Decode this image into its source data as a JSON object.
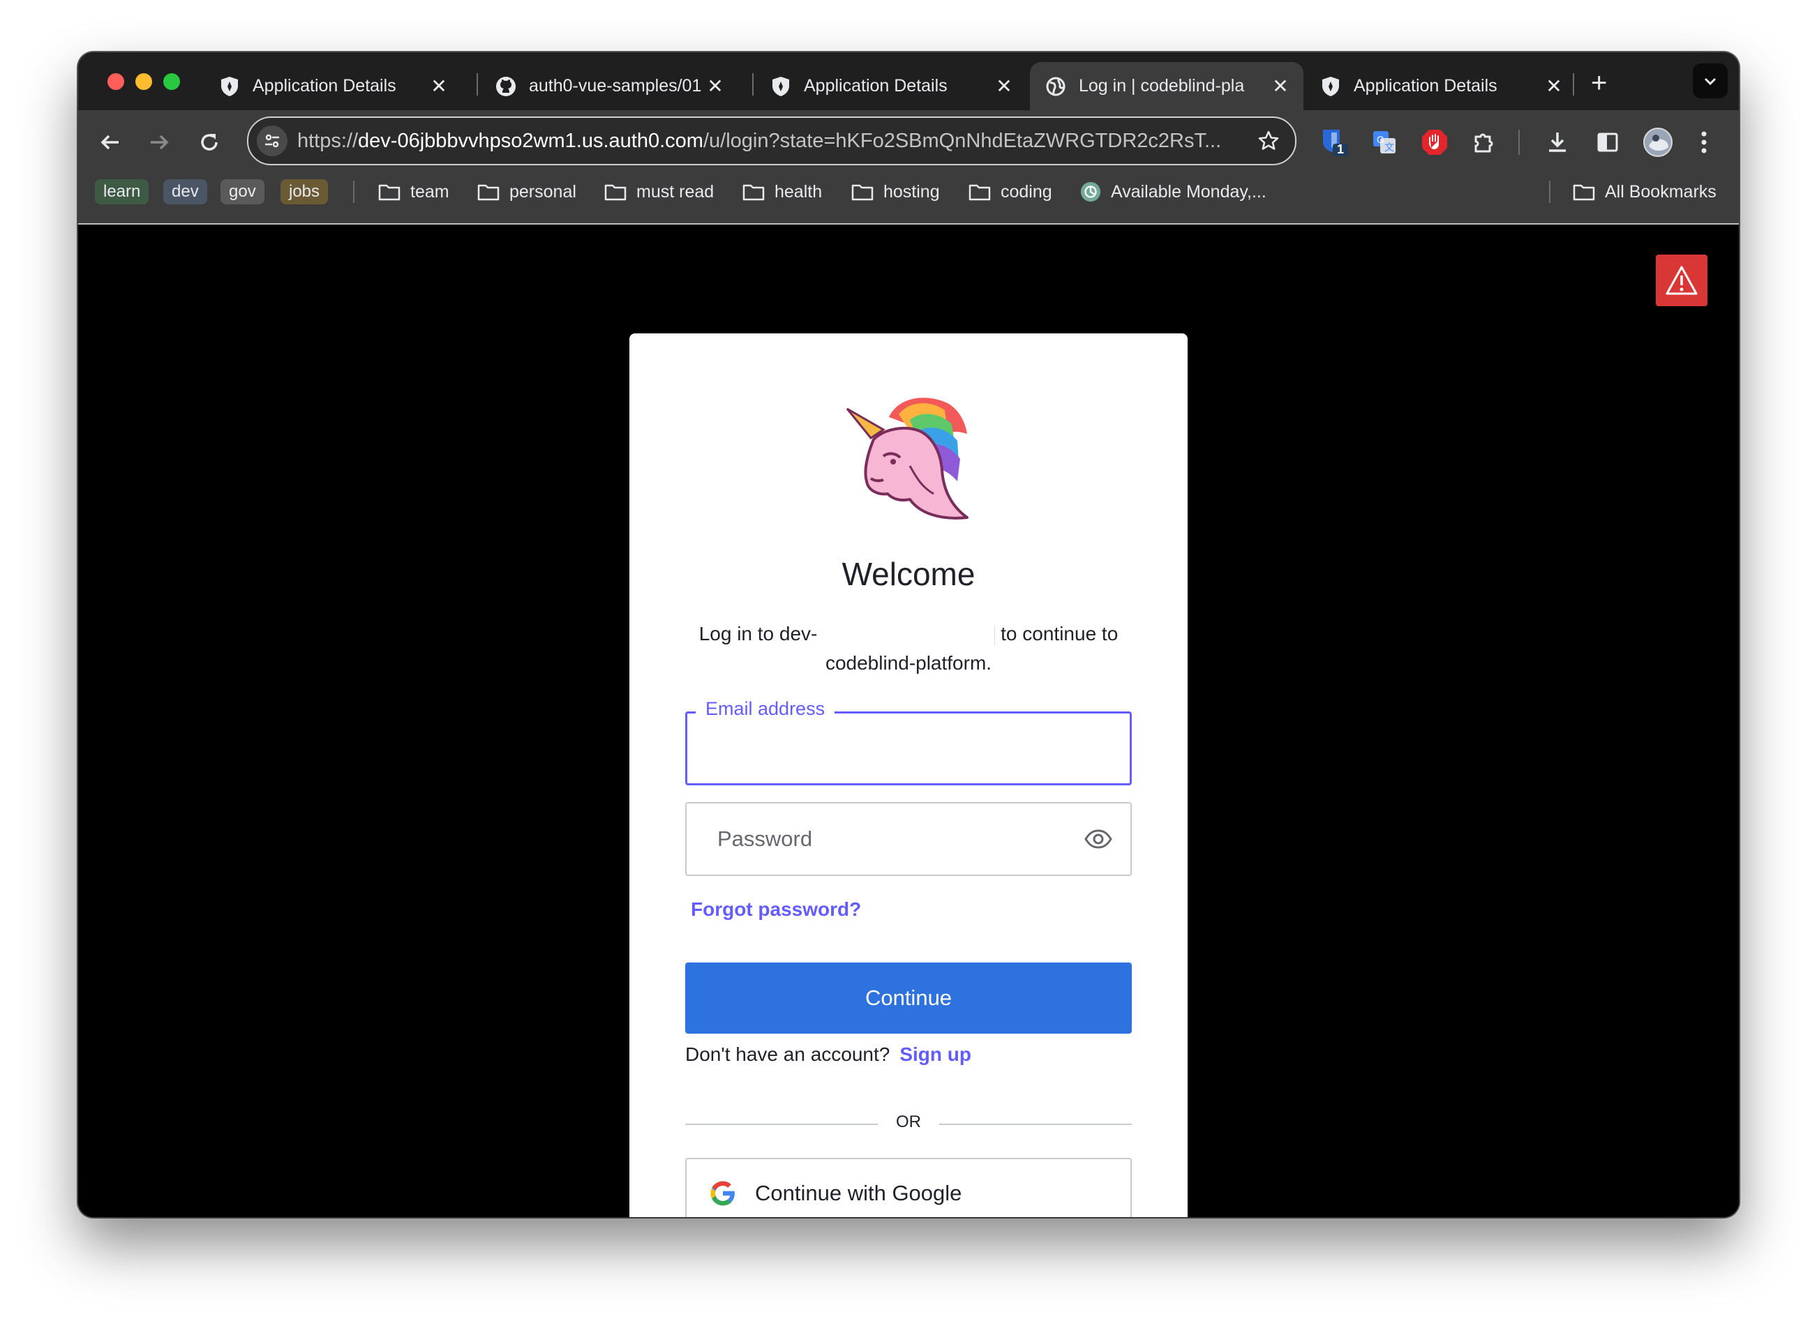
{
  "tabs": [
    {
      "title": "Application Details",
      "icon": "auth0-shield-icon"
    },
    {
      "title": "auth0-vue-samples/01",
      "icon": "github-icon"
    },
    {
      "title": "Application Details",
      "icon": "auth0-shield-icon"
    },
    {
      "title": "Log in | codeblind-pla",
      "icon": "globe-icon",
      "active": true
    },
    {
      "title": "Application Details",
      "icon": "auth0-shield-icon"
    }
  ],
  "tab_close_glyph": "✕",
  "new_tab_glyph": "+",
  "omnibox": {
    "scheme": "https://",
    "host": "dev-06jbbbvvhpso2wm1.us.auth0.com",
    "path": "/u/login?state=hKFo2SBmQnNhdEtaZWRGTDR2c2RsT..."
  },
  "extensions": {
    "badge_count": "1"
  },
  "bookmarks": {
    "chips": [
      {
        "label": "learn",
        "color": "#3f5a44"
      },
      {
        "label": "dev",
        "color": "#4a5566"
      },
      {
        "label": "gov",
        "color": "#5a5a5a"
      },
      {
        "label": "jobs",
        "color": "#6b5b34"
      }
    ],
    "folders": [
      "team",
      "personal",
      "must read",
      "health",
      "hosting",
      "coding"
    ],
    "link": "Available Monday,...",
    "all": "All Bookmarks"
  },
  "login": {
    "title": "Welcome",
    "desc_prefix": "Log in to dev-",
    "desc_suffix": "to continue to",
    "app_name": "codeblind-platform.",
    "email_label": "Email address",
    "email_value": "",
    "password_placeholder": "Password",
    "forgot": "Forgot password?",
    "continue": "Continue",
    "no_account": "Don't have an account?",
    "signup": "Sign up",
    "or": "OR",
    "google": "Continue with Google"
  },
  "colors": {
    "accent": "#635dff",
    "primary_button": "#2d72de",
    "warning": "#d93636"
  }
}
